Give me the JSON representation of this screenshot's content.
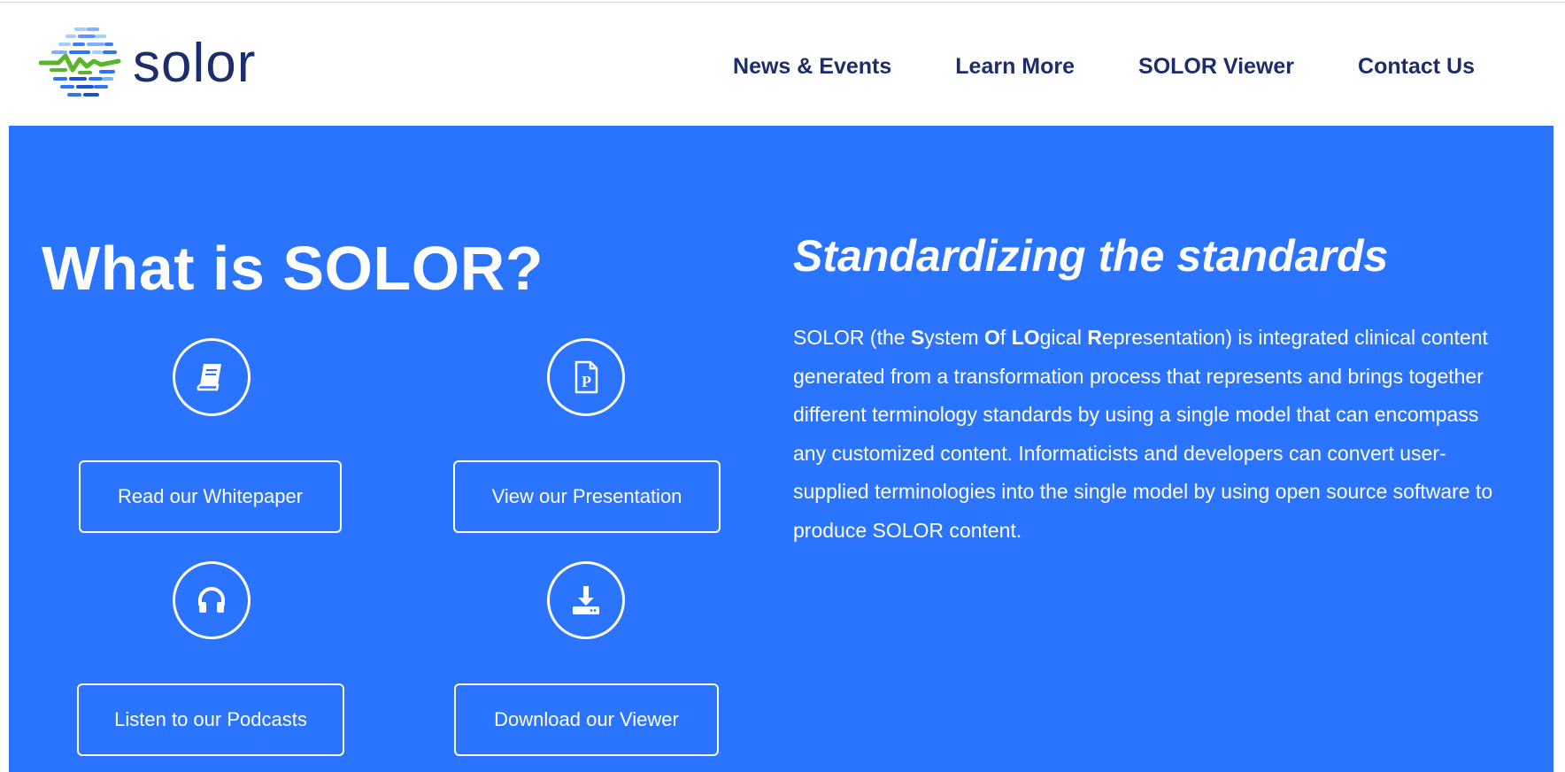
{
  "header": {
    "logo_text": "solor",
    "nav": [
      "News & Events",
      "Learn More",
      "SOLOR Viewer",
      "Contact Us"
    ]
  },
  "hero": {
    "title": "What is SOLOR?",
    "tagline": "Standardizing the standards",
    "description": {
      "p1": "SOLOR (the ",
      "s": "S",
      "p2": "ystem ",
      "o": "O",
      "p3": "f ",
      "lo": "LO",
      "p4": "gical ",
      "r": "R",
      "p5": "epresentation) is integrated clinical content generated from a transformation process that represents and brings together different terminology standards by using a single model that can encompass any customized content. Informaticists and developers can convert user-supplied terminologies into the single model by using open source software to produce SOLOR content."
    },
    "actions": [
      {
        "label": "Read our Whitepaper",
        "icon": "book-icon"
      },
      {
        "label": "View our Presentation",
        "icon": "presentation-file-icon"
      },
      {
        "label": "Listen to our Podcasts",
        "icon": "headphones-icon"
      },
      {
        "label": "Download our Viewer",
        "icon": "download-icon"
      }
    ]
  },
  "colors": {
    "hero_bg": "#2b74ff",
    "nav_text": "#1c2d6b",
    "logo_green": "#59b52a",
    "logo_blue": "#2b74ff"
  }
}
